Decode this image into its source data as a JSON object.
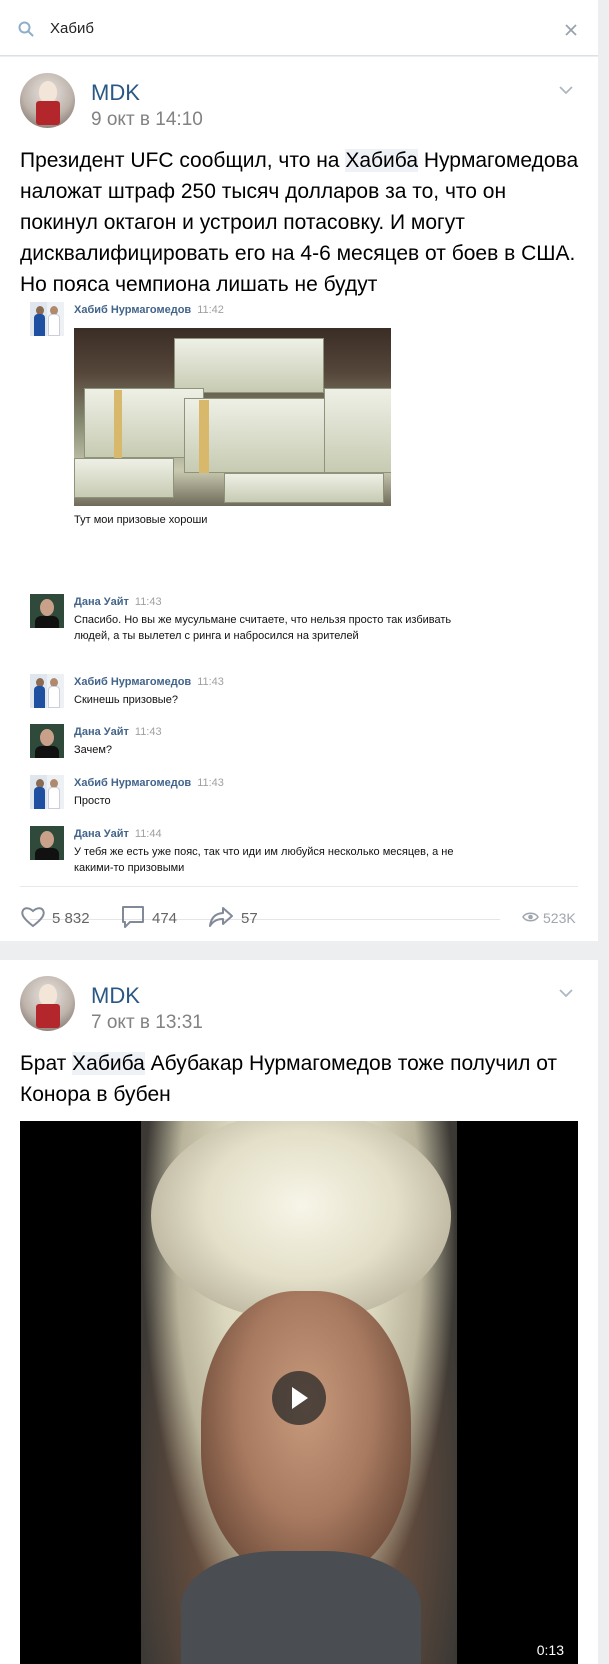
{
  "search": {
    "query": "Хабиб"
  },
  "posts": [
    {
      "author": "MDK",
      "date": "9 окт в 14:10",
      "text_pre": "Президент UFC сообщил, что на ",
      "text_highlight": "Хабиба",
      "text_post": " Нурмагомедова наложат штраф 250 тысяч долларов за то, что он покинул октагон и устроил потасовку. И могут дисквалифицировать его на 4-6 месяцев от боев в США. Но пояса чемпиона лишать не будут",
      "chat": [
        {
          "name": "Хабиб Нурмагомедов",
          "time": "11:42",
          "text": "Тут мои призовые хороши"
        },
        {
          "name": "Дана Уайт",
          "time": "11:43",
          "text": "Спасибо. Но вы же мусульмане считаете, что нельзя просто так избивать людей, а ты вылетел с ринга и набросился на зрителей"
        },
        {
          "name": "Хабиб Нурмагомедов",
          "time": "11:43",
          "text": "Скинешь призовые?"
        },
        {
          "name": "Дана Уайт",
          "time": "11:43",
          "text": "Зачем?"
        },
        {
          "name": "Хабиб Нурмагомедов",
          "time": "11:43",
          "text": "Просто"
        },
        {
          "name": "Дана Уайт",
          "time": "11:44",
          "text": "У тебя же есть уже пояс, так что иди им любуйся несколько месяцев, а не какими-то призовыми"
        }
      ],
      "likes": "5 832",
      "comments": "474",
      "shares": "57",
      "views": "523K"
    },
    {
      "author": "MDK",
      "date": "7 окт в 13:31",
      "text_pre": "Брат ",
      "text_highlight": "Хабиба",
      "text_post": " Абубакар Нурмагомедов тоже получил от Конора в бубен",
      "video_duration": "0:13"
    }
  ],
  "icons": {
    "search": "search-icon",
    "clear": "close-icon",
    "menu": "chevron-down-icon",
    "like": "heart-icon",
    "comment": "comment-icon",
    "share": "share-icon",
    "views": "eye-icon",
    "play": "play-icon"
  },
  "colors": {
    "link": "#2a5885",
    "chat_name": "#42648b",
    "background": "#edeef0"
  }
}
